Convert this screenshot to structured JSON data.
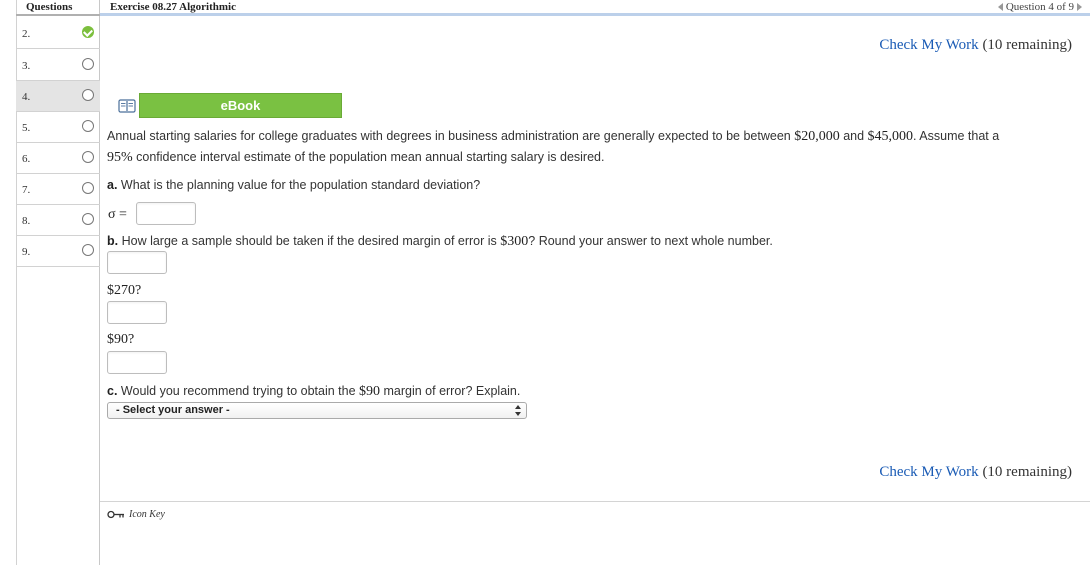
{
  "sidebar": {
    "header": "Questions",
    "items": [
      {
        "number": "2.",
        "status": "done"
      },
      {
        "number": "3.",
        "status": "empty"
      },
      {
        "number": "4.",
        "status": "empty",
        "current": true
      },
      {
        "number": "5.",
        "status": "empty"
      },
      {
        "number": "6.",
        "status": "empty"
      },
      {
        "number": "7.",
        "status": "empty"
      },
      {
        "number": "8.",
        "status": "empty"
      },
      {
        "number": "9.",
        "status": "empty"
      }
    ]
  },
  "header": {
    "title": "Exercise 08.27 Algorithmic",
    "question_nav": "Question 4 of 9"
  },
  "check_work": {
    "link": "Check My Work",
    "remaining": "(10 remaining)"
  },
  "ebook": {
    "label": "eBook"
  },
  "intro": {
    "line1_a": "Annual starting salaries for college graduates with degrees in business administration are generally expected to be between ",
    "low": "$20,000",
    "and": " and ",
    "high": "$45,000",
    "line1_b": ". Assume that a",
    "conf": "95%",
    "line2": " confidence interval estimate of the population mean annual starting salary is desired."
  },
  "part_a": {
    "label": "a.",
    "question": "What is the planning value for the population standard deviation?",
    "sigma_label": "σ ="
  },
  "part_b": {
    "label": "b.",
    "question_a": "How large a sample should be taken if the desired margin of error is ",
    "margin": "$300",
    "question_b": "? Round your answer to next whole number.",
    "alt1": "$270?",
    "alt2": "$90?"
  },
  "part_c": {
    "label": "c.",
    "question_a": "Would you recommend trying to obtain the ",
    "margin": "$90",
    "question_b": " margin of error? Explain.",
    "select_value": "- Select your answer -"
  },
  "footer": {
    "icon_key": "Icon Key"
  },
  "colors": {
    "accent_green": "#7ac142",
    "link_blue": "#1a5bb5",
    "header_rule": "#bcd0ea"
  }
}
